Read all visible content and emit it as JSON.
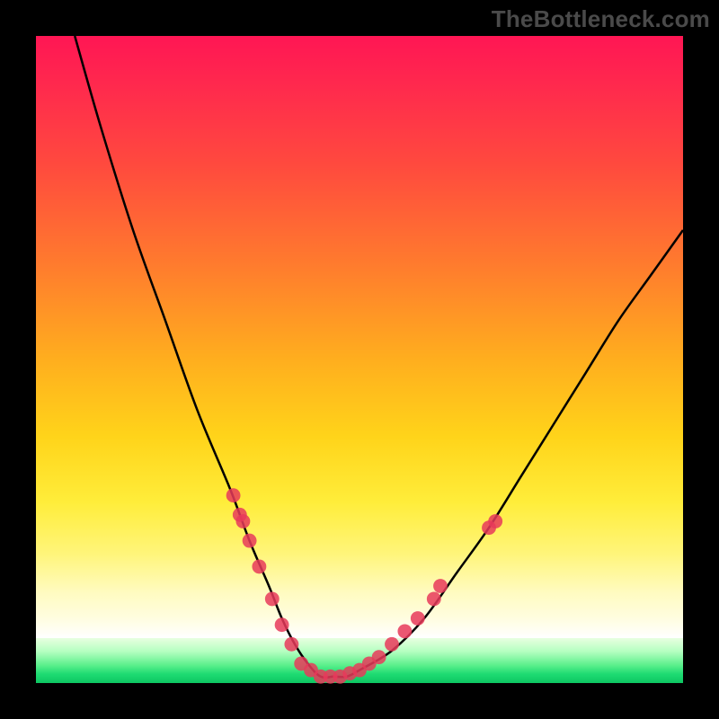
{
  "watermark": "TheBottleneck.com",
  "chart_data": {
    "type": "line",
    "title": "",
    "xlabel": "",
    "ylabel": "",
    "xlim": [
      0,
      100
    ],
    "ylim": [
      0,
      100
    ],
    "grid": false,
    "legend": false,
    "series": [
      {
        "name": "bottleneck-curve",
        "x": [
          6,
          10,
          15,
          20,
          25,
          30,
          33,
          36,
          38,
          40,
          42,
          44,
          46,
          48,
          50,
          55,
          60,
          65,
          70,
          75,
          80,
          85,
          90,
          95,
          100
        ],
        "y": [
          100,
          86,
          70,
          56,
          42,
          30,
          22,
          15,
          10,
          6,
          3,
          1,
          1,
          1,
          2,
          5,
          10,
          17,
          24,
          32,
          40,
          48,
          56,
          63,
          70
        ]
      }
    ],
    "markers": [
      {
        "x": 30.5,
        "y": 29
      },
      {
        "x": 31.5,
        "y": 26
      },
      {
        "x": 32.0,
        "y": 25
      },
      {
        "x": 33.0,
        "y": 22
      },
      {
        "x": 34.5,
        "y": 18
      },
      {
        "x": 36.5,
        "y": 13
      },
      {
        "x": 38.0,
        "y": 9
      },
      {
        "x": 39.5,
        "y": 6
      },
      {
        "x": 41.0,
        "y": 3
      },
      {
        "x": 42.5,
        "y": 2
      },
      {
        "x": 44.0,
        "y": 1
      },
      {
        "x": 45.5,
        "y": 1
      },
      {
        "x": 47.0,
        "y": 1
      },
      {
        "x": 48.5,
        "y": 1.5
      },
      {
        "x": 50.0,
        "y": 2
      },
      {
        "x": 51.5,
        "y": 3
      },
      {
        "x": 53.0,
        "y": 4
      },
      {
        "x": 55.0,
        "y": 6
      },
      {
        "x": 57.0,
        "y": 8
      },
      {
        "x": 59.0,
        "y": 10
      },
      {
        "x": 61.5,
        "y": 13
      },
      {
        "x": 62.5,
        "y": 15
      },
      {
        "x": 70.0,
        "y": 24
      },
      {
        "x": 71.0,
        "y": 25
      }
    ],
    "marker_color": "#e83a5a",
    "curve_color": "#000000"
  }
}
